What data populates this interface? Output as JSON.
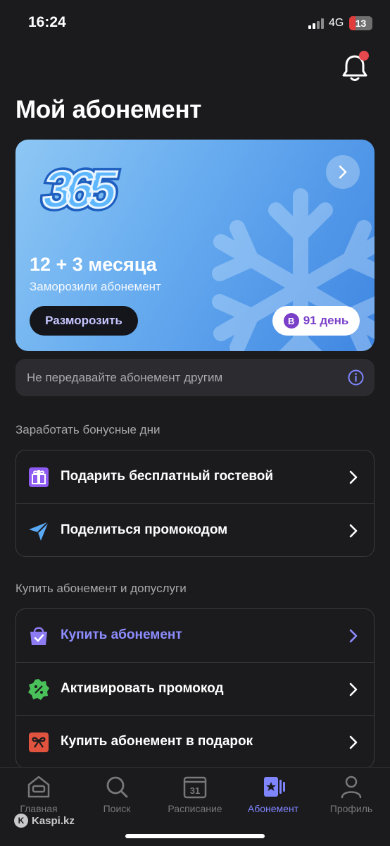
{
  "status_bar": {
    "time": "16:24",
    "network": "4G",
    "battery": "13"
  },
  "page": {
    "title": "Мой абонемент"
  },
  "card": {
    "term": "12 + 3 месяца",
    "status": "Заморозили абонемент",
    "unfreeze_label": "Разморозить",
    "days_badge_letter": "В",
    "days_label": "91 день"
  },
  "notice": {
    "text": "Не передавайте абонемент другим"
  },
  "bonus_section": {
    "title": "Заработать бонусные дни",
    "items": [
      {
        "label": "Подарить бесплатный гостевой",
        "icon": "gift-icon"
      },
      {
        "label": "Поделиться промокодом",
        "icon": "send-icon"
      }
    ]
  },
  "buy_section": {
    "title": "Купить абонемент и допуслуги",
    "items": [
      {
        "label": "Купить абонемент",
        "icon": "shopping-bag-icon",
        "accent": "#7f85ff"
      },
      {
        "label": "Активировать промокод",
        "icon": "percent-badge-icon"
      },
      {
        "label": "Купить абонемент в подарок",
        "icon": "gift-box-icon"
      }
    ]
  },
  "tabbar": {
    "tabs": [
      {
        "label": "Главная",
        "icon": "home-icon"
      },
      {
        "label": "Поиск",
        "icon": "search-icon"
      },
      {
        "label": "Расписание",
        "icon": "calendar-icon",
        "icon_text": "31"
      },
      {
        "label": "Абонемент",
        "icon": "membership-icon",
        "active": true
      },
      {
        "label": "Профиль",
        "icon": "profile-icon"
      }
    ]
  },
  "watermark": {
    "text": "Kaspi.kz"
  },
  "colors": {
    "background": "#1b1b1d",
    "accent": "#7f85ff",
    "card_gradient_start": "#8ec7f4",
    "card_gradient_end": "#3f86e2",
    "notification_dot": "#e5484d"
  }
}
